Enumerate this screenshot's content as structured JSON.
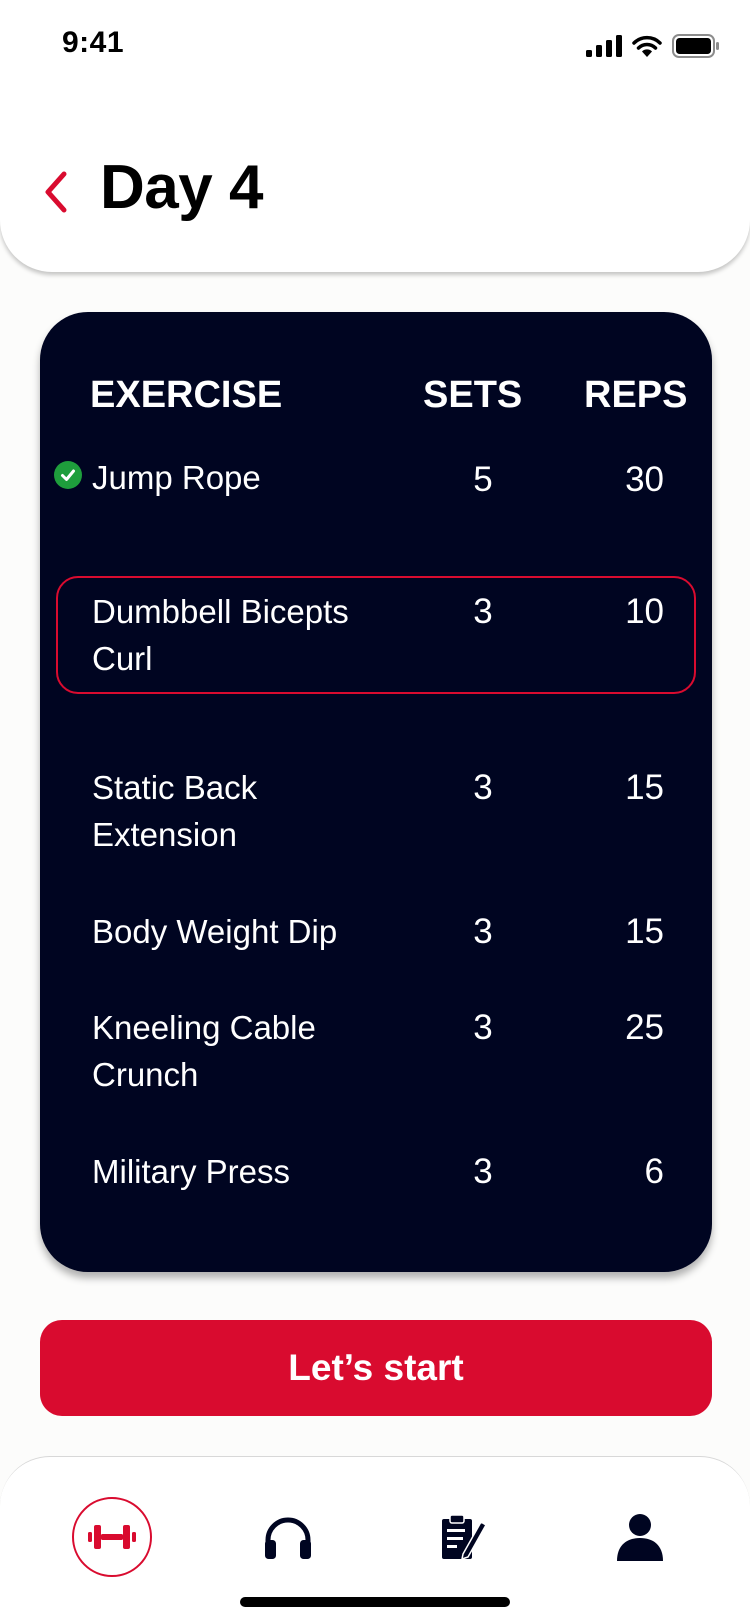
{
  "status_bar": {
    "time": "9:41"
  },
  "header": {
    "title": "Day 4"
  },
  "table": {
    "headers": {
      "exercise": "EXERCISE",
      "sets": "SETS",
      "reps": "REPS"
    },
    "rows": [
      {
        "name": "Jump Rope",
        "sets": "5",
        "reps": "30",
        "completed": true
      },
      {
        "name": "Dumbbell Bicepts Curl",
        "sets": "3",
        "reps": "10",
        "current": true
      },
      {
        "name": "Static Back Extension",
        "sets": "3",
        "reps": "15"
      },
      {
        "name": "Body Weight Dip",
        "sets": "3",
        "reps": "15"
      },
      {
        "name": "Kneeling Cable Crunch",
        "sets": "3",
        "reps": "25"
      },
      {
        "name": "Military Press",
        "sets": "3",
        "reps": "6"
      }
    ]
  },
  "cta": {
    "label": "Let’s start"
  },
  "tabbar": {
    "items": [
      {
        "icon": "dumbbell-icon",
        "active": true
      },
      {
        "icon": "headphones-icon",
        "active": false
      },
      {
        "icon": "clipboard-icon",
        "active": false
      },
      {
        "icon": "person-icon",
        "active": false
      }
    ]
  },
  "colors": {
    "accent": "#d90b2f",
    "card": "#000521",
    "check": "#1e9e3c"
  }
}
